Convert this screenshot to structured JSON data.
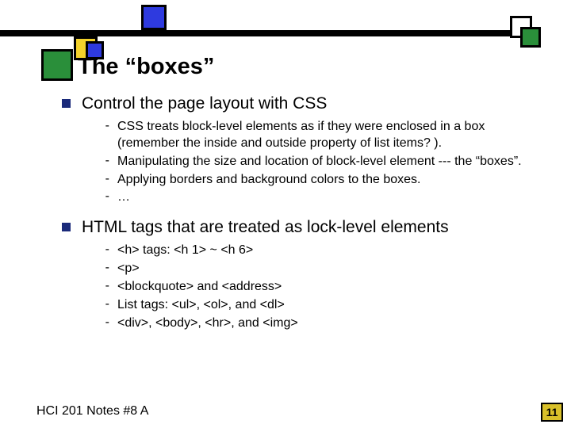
{
  "title": "The “boxes”",
  "sections": [
    {
      "heading": "Control the page layout with CSS",
      "items": [
        "CSS treats block-level elements as if they were enclosed in a box (remember the inside and outside property of list items? ).",
        "Manipulating the size and location of block-level element --- the “boxes”.",
        "Applying borders and background colors to the boxes.",
        "…"
      ]
    },
    {
      "heading": "HTML tags that are treated as lock-level elements",
      "items": [
        "<h> tags: <h 1> ~ <h 6>",
        "<p>",
        "<blockquote> and <address>",
        "List tags: <ul>, <ol>, and <dl>",
        "<div>, <body>, <hr>, and <img>"
      ]
    }
  ],
  "footer": {
    "left": "HCI 201 Notes #8 A",
    "page": "11"
  }
}
